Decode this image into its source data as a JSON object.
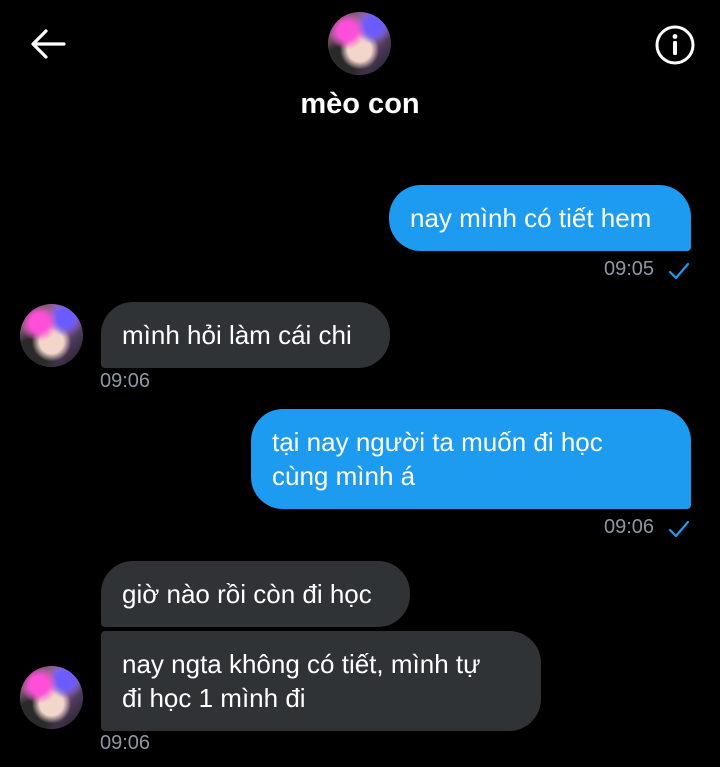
{
  "header": {
    "title": "mèo con",
    "back_icon": "arrow-left-icon",
    "info_icon": "info-icon"
  },
  "colors": {
    "background": "#000000",
    "sent_bubble": "#1d9bf0",
    "received_bubble": "#2f3336",
    "timestamp": "#8b98a5"
  },
  "messages": [
    {
      "direction": "sent",
      "text": "nay mình có tiết hem",
      "time": "09:05",
      "status_icon": "check-icon"
    },
    {
      "direction": "received",
      "text": "mình hỏi làm cái chi",
      "time": "09:06"
    },
    {
      "direction": "sent",
      "text_line1": "tại nay người ta muốn đi học",
      "text_line2": "cùng mình á",
      "time": "09:06",
      "status_icon": "check-icon"
    },
    {
      "direction": "received",
      "text": "giờ nào rồi còn đi học"
    },
    {
      "direction": "received",
      "text_line1": "nay ngta không có tiết, mình tự",
      "text_line2": "đi học 1 mình đi",
      "time": "09:06"
    }
  ]
}
